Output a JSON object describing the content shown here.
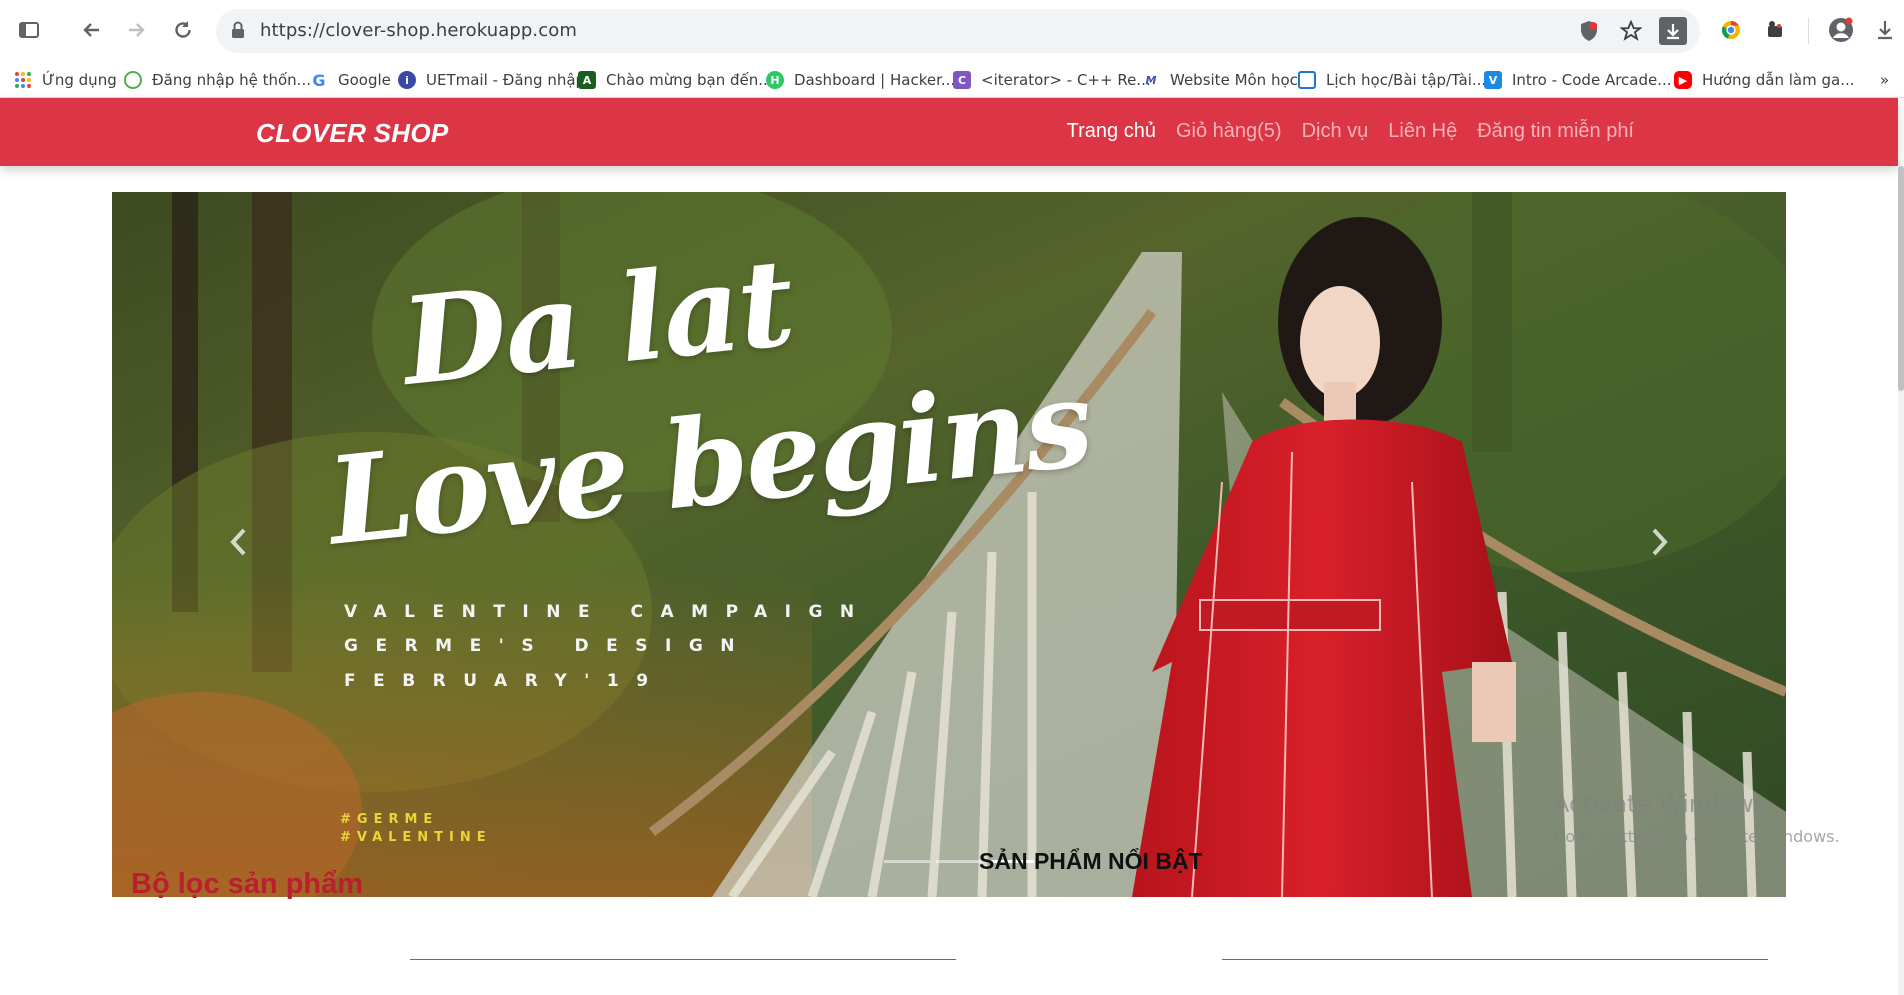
{
  "browser": {
    "url": "https://clover-shop.herokuapp.com",
    "bookmarks": [
      {
        "label": "Ứng dụng",
        "icon": "apps-grid-icon"
      },
      {
        "label": "Đăng nhập hệ thốn...",
        "icon": "globe-icon"
      },
      {
        "label": "Google",
        "icon": "google-icon"
      },
      {
        "label": "UETmail - Đăng nhập",
        "icon": "info-icon"
      },
      {
        "label": "Chào mừng bạn đến...",
        "icon": "code-icon"
      },
      {
        "label": "Dashboard | Hacker...",
        "icon": "hackerrank-icon"
      },
      {
        "label": "<iterator> - C++ Re...",
        "icon": "cpp-icon"
      },
      {
        "label": "Website Môn học",
        "icon": "moodle-icon"
      },
      {
        "label": "Lịch học/Bài tập/Tài...",
        "icon": "calendar-icon"
      },
      {
        "label": "Intro - Code Arcade...",
        "icon": "codesignal-icon"
      },
      {
        "label": "Hướng dẫn làm ga...",
        "icon": "youtube-icon"
      }
    ],
    "more_label": "»"
  },
  "navbar": {
    "brand": "CLOVER SHOP",
    "links": [
      "Trang chủ",
      "Giỏ hàng(5)",
      "Dịch vụ",
      "Liên Hệ",
      "Đăng tin miễn phí"
    ],
    "active_index": 0,
    "bg_color": "#dc3545"
  },
  "carousel": {
    "script_line1": "Da lat",
    "script_line2": "Love begins",
    "campaign": "VALENTINE CAMPAIGN",
    "design": "GERME'S DESIGN",
    "date": "FEBRUARY'19",
    "tag1": "#GERME",
    "tag2": "#VALENTINE",
    "slide_count": 3,
    "active_slide": 2
  },
  "sections": {
    "featured_title": "SẢN PHẨM NỔI BẬT",
    "filter_title": "Bộ lọc sản phẩm"
  },
  "watermark": {
    "line1": "Activate Windows",
    "line2": "Go to Settings to activate Windows."
  }
}
